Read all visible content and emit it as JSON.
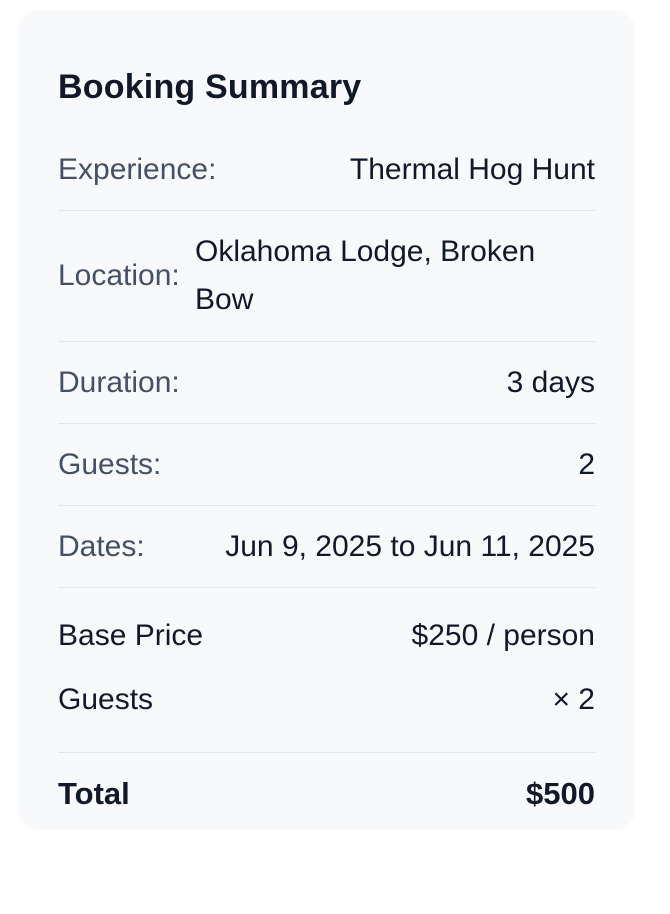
{
  "booking_summary": {
    "title": "Booking Summary",
    "details": {
      "experience": {
        "label": "Experience:",
        "value": "Thermal Hog Hunt"
      },
      "location": {
        "label": "Location:",
        "value": "Oklahoma Lodge, Broken Bow"
      },
      "duration": {
        "label": "Duration:",
        "value": "3 days"
      },
      "guests": {
        "label": "Guests:",
        "value": "2"
      },
      "dates": {
        "label": "Dates:",
        "value": "Jun 9, 2025 to Jun 11, 2025"
      }
    },
    "pricing": {
      "base_price": {
        "label": "Base Price",
        "value": "$250 / person"
      },
      "guests_multiplier": {
        "label": "Guests",
        "value": "× 2"
      },
      "total": {
        "label": "Total",
        "value": "$500"
      }
    }
  }
}
